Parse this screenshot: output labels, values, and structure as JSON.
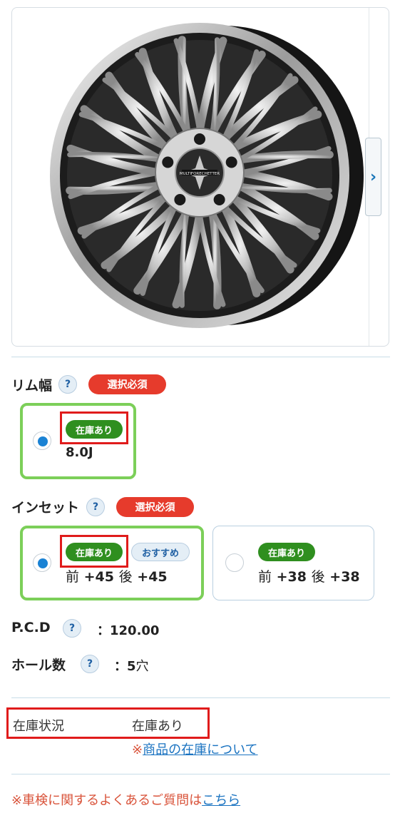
{
  "gallery": {
    "next_icon": "chevron-right-icon",
    "next_symbol": "›",
    "wheel_logo_text": "MULTIFORECHETTER"
  },
  "rim_width": {
    "label": "リム幅",
    "help": "?",
    "required_badge": "選択必須",
    "options": [
      {
        "stock": "在庫あり",
        "value": "8.0J",
        "selected": true
      }
    ]
  },
  "inset": {
    "label": "インセット",
    "help": "?",
    "required_badge": "選択必須",
    "options": [
      {
        "stock": "在庫あり",
        "recommend": "おすすめ",
        "front_label": "前",
        "front_value": "+45",
        "rear_label": "後",
        "rear_value": "+45",
        "selected": true
      },
      {
        "stock": "在庫あり",
        "front_label": "前",
        "front_value": "+38",
        "rear_label": "後",
        "rear_value": "+38",
        "selected": false
      }
    ]
  },
  "pcd": {
    "label": "P.C.D",
    "help": "?",
    "separator": "：",
    "value": "120.00"
  },
  "holes": {
    "label": "ホール数",
    "help": "?",
    "separator": "：",
    "value_num": "5",
    "value_unit": "穴"
  },
  "stock_status": {
    "label": "在庫状況",
    "value": "在庫あり",
    "note_prefix": "※",
    "note_link": "商品の在庫について"
  },
  "faq": {
    "prefix": "※車検に関するよくあるご質問は",
    "link": "こちら"
  },
  "colors": {
    "required_red": "#e63b2c",
    "stock_green": "#2f8f1f",
    "selected_border": "#7ccf59",
    "highlight_red": "#e01b1b",
    "link_blue": "#1a73c1"
  }
}
